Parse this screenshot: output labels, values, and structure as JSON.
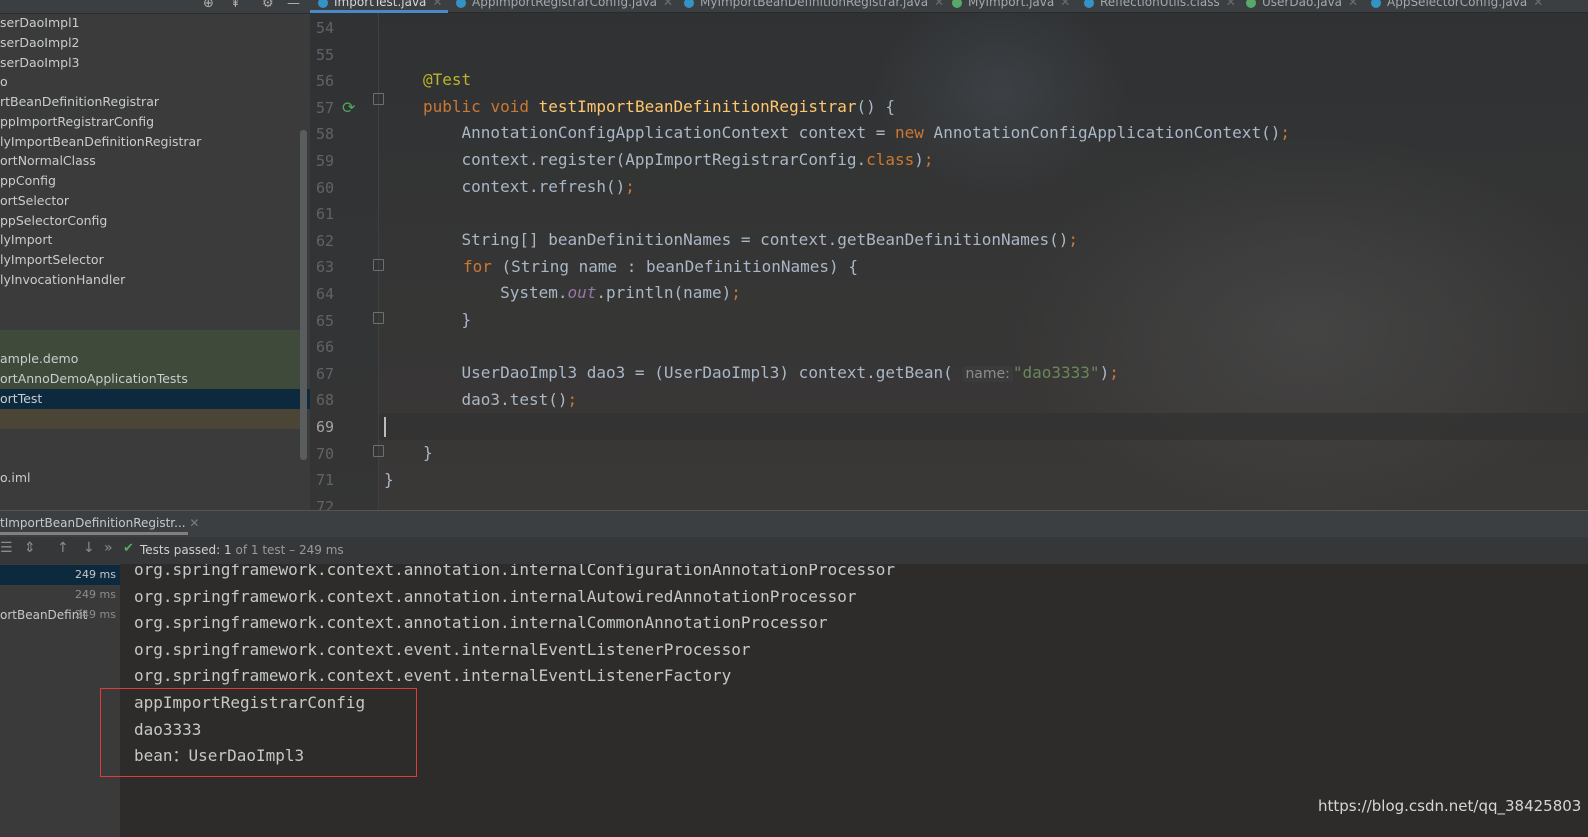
{
  "project_tree": {
    "items": [
      "serDaoImpl1",
      "serDaoImpl2",
      "serDaoImpl3",
      "o",
      "rtBeanDefinitionRegistrar",
      "ppImportRegistrarConfig",
      "lyImportBeanDefinitionRegistrar",
      "ortNormalClass",
      "ppConfig",
      "ortSelector",
      "ppSelectorConfig",
      "lyImport",
      "lyImportSelector",
      "lyInvocationHandler",
      "ample.demo",
      "ortAnnoDemoApplicationTests",
      "ortTest",
      "o.iml"
    ]
  },
  "editor_tabs": [
    {
      "label": "ImportTest.java",
      "color": "#3592c4",
      "active": true
    },
    {
      "label": "AppImportRegistrarConfig.java",
      "color": "#3592c4"
    },
    {
      "label": "MyImportBeanDefinitionRegistrar.java",
      "color": "#3592c4"
    },
    {
      "label": "MyImport.java",
      "color": "#59a869"
    },
    {
      "label": "ReflectionUtils.class",
      "color": "#3592c4"
    },
    {
      "label": "UserDao.java",
      "color": "#59a869"
    },
    {
      "label": "AppSelectorConfig.java",
      "color": "#3592c4"
    }
  ],
  "editor": {
    "line_numbers": [
      "54",
      "55",
      "56",
      "57",
      "58",
      "59",
      "60",
      "61",
      "62",
      "63",
      "64",
      "65",
      "66",
      "67",
      "68",
      "69",
      "70",
      "71",
      "72"
    ],
    "current_line": "69",
    "code": {
      "l56_ann": "@Test",
      "l57_kw1": "public",
      "l57_kw2": "void",
      "l57_fn": "testImportBeanDefinitionRegistrar",
      "l57_rest": "() {",
      "l58_a": "    AnnotationConfigApplicationContext context = ",
      "l58_kw": "new",
      "l58_b": " AnnotationConfigApplicationContext()",
      "l58_semi": ";",
      "l59_a": "    context.register(AppImportRegistrarConfig.",
      "l59_kw": "class",
      "l59_b": ")",
      "l59_semi": ";",
      "l60_a": "    context.refresh()",
      "l60_semi": ";",
      "l62_a": "    String[] beanDefinitionNames = context.getBeanDefinitionNames()",
      "l62_semi": ";",
      "l63_kw": "for",
      "l63_b": " (String name : beanDefinitionNames) {",
      "l64_a": "        System.",
      "l64_field": "out",
      "l64_b": ".println(name)",
      "l64_semi": ";",
      "l65": "    }",
      "l67_a": "    UserDaoImpl3 dao3 = (UserDaoImpl3) context.getBean( ",
      "l67_hint": "name:",
      "l67_str": "\"dao3333\"",
      "l67_b": ")",
      "l67_semi": ";",
      "l68_a": "    dao3.test()",
      "l68_semi": ";",
      "l70": "}",
      "l71": "}"
    }
  },
  "run_panel": {
    "tab_label": "tImportBeanDefinitionRegistr...",
    "status_passed": "Tests passed: 1",
    "status_rest": " of 1 test – 249 ms",
    "test_tree": [
      {
        "label": "",
        "duration": "249 ms"
      },
      {
        "label": "",
        "duration": "249 ms"
      },
      {
        "label": "ortBeanDefinit",
        "duration": "249 ms"
      }
    ],
    "console_lines": [
      "org.springframework.context.annotation.internalConfigurationAnnotationProcessor",
      "org.springframework.context.annotation.internalAutowiredAnnotationProcessor",
      "org.springframework.context.annotation.internalCommonAnnotationProcessor",
      "org.springframework.context.event.internalEventListenerProcessor",
      "org.springframework.context.event.internalEventListenerFactory",
      "appImportRegistrarConfig",
      "dao3333",
      "bean：UserDaoImpl3"
    ]
  },
  "watermark": "https://blog.csdn.net/qq_38425803",
  "colors": {
    "keyword": "#cc7832",
    "annotation": "#bbb529",
    "function": "#ffc66d",
    "string": "#6a8759",
    "highlight_box": "#e23b3b"
  }
}
